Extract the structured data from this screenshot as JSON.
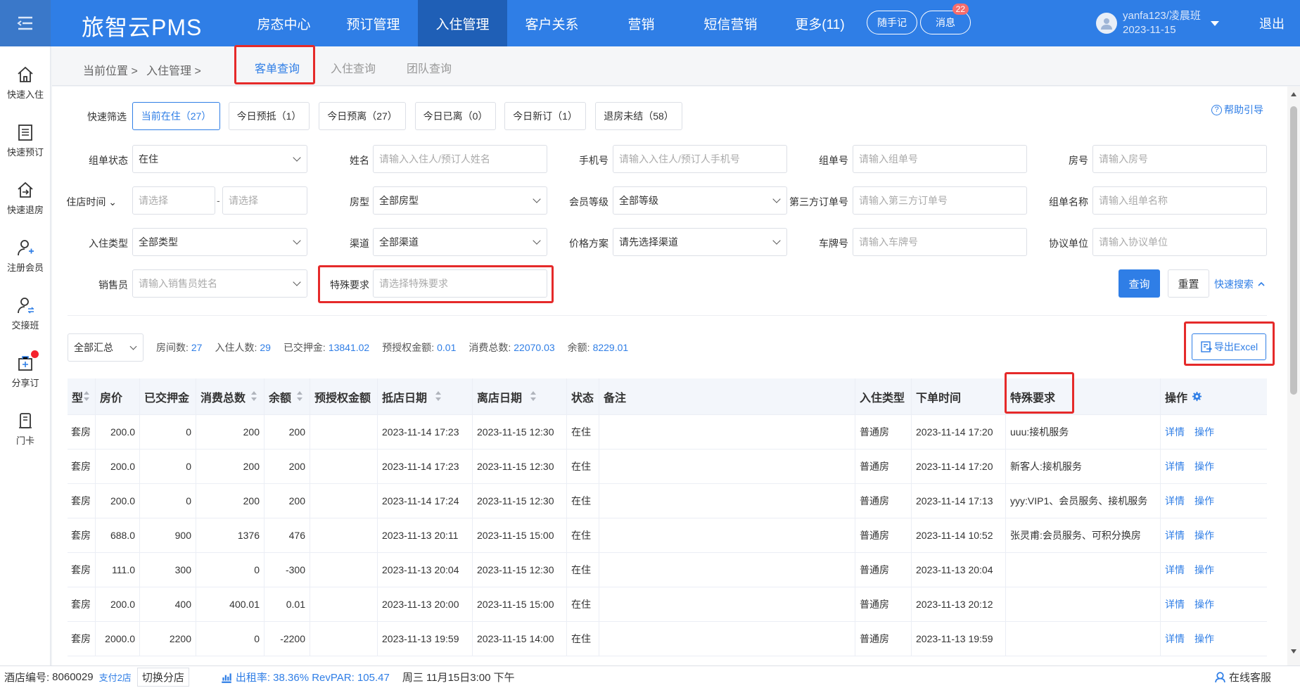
{
  "app": {
    "logo": "旅智云PMS",
    "logout": "退出"
  },
  "nav": [
    {
      "label": "房态中心"
    },
    {
      "label": "预订管理"
    },
    {
      "label": "入住管理",
      "active": true
    },
    {
      "label": "客户关系"
    },
    {
      "label": "营销"
    },
    {
      "label": "短信营销"
    },
    {
      "label": "更多(11)"
    }
  ],
  "header": {
    "notes": "随手记",
    "messages": "消息",
    "messages_badge": "22",
    "user": "yanfa123/凌晨班",
    "date": "2023-11-15"
  },
  "sidebar": [
    {
      "label": "快速入住",
      "icon": "home-icon"
    },
    {
      "label": "快速预订",
      "icon": "booking-icon"
    },
    {
      "label": "快速退房",
      "icon": "checkout-icon"
    },
    {
      "label": "注册会员",
      "icon": "add-user-icon"
    },
    {
      "label": "交接班",
      "icon": "shift-handover-icon"
    },
    {
      "label": "分享订",
      "icon": "share-icon",
      "dot": true
    },
    {
      "label": "门卡",
      "icon": "door-card-icon"
    }
  ],
  "breadcrumb": {
    "current": "当前位置 >",
    "module": "入住管理 >"
  },
  "tabs": [
    {
      "label": "客单查询",
      "active": true
    },
    {
      "label": "入住查询"
    },
    {
      "label": "团队查询"
    }
  ],
  "quick_filter": {
    "label": "快速筛选",
    "items": [
      "当前在住（27）",
      "今日预抵（1）",
      "今日预离（27）",
      "今日已离（0）",
      "今日新订（1）",
      "退房未结（58）"
    ]
  },
  "help": "帮助引导",
  "form": {
    "order_status": {
      "label": "组单状态",
      "value": "在住"
    },
    "name": {
      "label": "姓名",
      "placeholder": "请输入入住人/预订人姓名"
    },
    "phone": {
      "label": "手机号",
      "placeholder": "请输入入住人/预订人手机号"
    },
    "group_no": {
      "label": "组单号",
      "placeholder": "请输入组单号"
    },
    "room_no": {
      "label": "房号",
      "placeholder": "请输入房号"
    },
    "stay_time": {
      "label": "住店时间",
      "start_placeholder": "请选择",
      "sep": "-",
      "end_placeholder": "请选择"
    },
    "room_type": {
      "label": "房型",
      "value": "全部房型"
    },
    "member_level": {
      "label": "会员等级",
      "value": "全部等级"
    },
    "third_party": {
      "label": "第三方订单号",
      "placeholder": "请输入第三方订单号"
    },
    "group_name": {
      "label": "组单名称",
      "placeholder": "请输入组单名称"
    },
    "checkin_type": {
      "label": "入住类型",
      "value": "全部类型"
    },
    "channel": {
      "label": "渠道",
      "value": "全部渠道"
    },
    "price_plan": {
      "label": "价格方案",
      "value": "请先选择渠道"
    },
    "plate": {
      "label": "车牌号",
      "placeholder": "请输入车牌号"
    },
    "agreement": {
      "label": "协议单位",
      "placeholder": "请输入协议单位"
    },
    "sales": {
      "label": "销售员",
      "placeholder": "请输入销售员姓名"
    },
    "special": {
      "label": "特殊要求",
      "placeholder": "请选择特殊要求"
    },
    "query": "查询",
    "reset": "重置",
    "quick_search": "快速搜索"
  },
  "summary": {
    "select": "全部汇总",
    "stats": [
      {
        "label": "房间数:",
        "value": "27"
      },
      {
        "label": "入住人数:",
        "value": "29"
      },
      {
        "label": "已交押金:",
        "value": "13841.02"
      },
      {
        "label": "预授权金额:",
        "value": "0.01"
      },
      {
        "label": "消费总数:",
        "value": "22070.03"
      },
      {
        "label": "余额:",
        "value": "8229.01"
      }
    ],
    "export": "导出Excel"
  },
  "table": {
    "columns": [
      "型",
      "房价",
      "已交押金",
      "消费总数",
      "余额",
      "预授权金额",
      "抵店日期",
      "离店日期",
      "状态",
      "备注",
      "入住类型",
      "下单时间",
      "特殊要求",
      "操作"
    ],
    "rows": [
      [
        "套房",
        "200.0",
        "0",
        "200",
        "200",
        "",
        "2023-11-14 17:23",
        "2023-11-15 12:30",
        "在住",
        "",
        "普通房",
        "2023-11-14 17:20",
        "uuu:接机服务"
      ],
      [
        "套房",
        "200.0",
        "0",
        "200",
        "200",
        "",
        "2023-11-14 17:23",
        "2023-11-15 12:30",
        "在住",
        "",
        "普通房",
        "2023-11-14 17:20",
        "新客人:接机服务"
      ],
      [
        "套房",
        "200.0",
        "0",
        "200",
        "200",
        "",
        "2023-11-14 17:24",
        "2023-11-15 12:30",
        "在住",
        "",
        "普通房",
        "2023-11-14 17:13",
        "yyy:VIP1、会员服务、接机服务"
      ],
      [
        "套房",
        "688.0",
        "900",
        "1376",
        "476",
        "",
        "2023-11-13 20:11",
        "2023-11-15 15:00",
        "在住",
        "",
        "普通房",
        "2023-11-14 10:52",
        "张灵甫:会员服务、可积分换房"
      ],
      [
        "套房",
        "111.0",
        "300",
        "0",
        "-300",
        "",
        "2023-11-13 20:04",
        "2023-11-15 12:30",
        "在住",
        "",
        "普通房",
        "2023-11-13 20:04",
        ""
      ],
      [
        "套房",
        "200.0",
        "400",
        "400.01",
        "0.01",
        "",
        "2023-11-13 20:00",
        "2023-11-15 15:00",
        "在住",
        "",
        "普通房",
        "2023-11-13 20:12",
        ""
      ],
      [
        "套房",
        "2000.0",
        "2200",
        "0",
        "-2200",
        "",
        "2023-11-13 19:59",
        "2023-11-15 14:00",
        "在住",
        "",
        "普通房",
        "2023-11-13 19:59",
        ""
      ]
    ],
    "detail": "详情",
    "action": "操作"
  },
  "statusbar": {
    "hotel_label": "酒店编号:",
    "hotel_no": "8060029",
    "pay": "支付2店",
    "switch": "切换分店",
    "occupancy": "出租率: 38.36% RevPAR: 105.47",
    "datetime": "周三 11月15日3:00 下午",
    "service": "在线客服"
  },
  "colors": {
    "primary": "#2f7ee6",
    "highlight": "#e52a2a",
    "nav_active": "#1f5fb6"
  }
}
